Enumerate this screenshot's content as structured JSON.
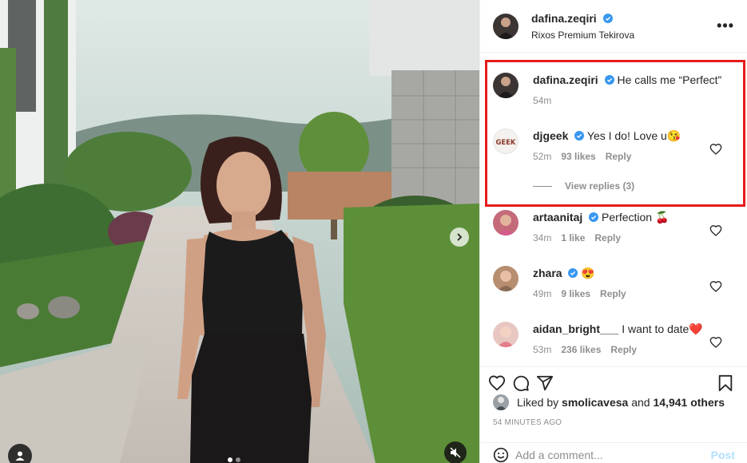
{
  "post": {
    "username": "dafina.zeqiri",
    "location": "Rixos Premium Tekirova",
    "more_label": "•••"
  },
  "comments": [
    {
      "username": "dafina.zeqiri",
      "verified": true,
      "text": "He calls me “Perfect”",
      "time": "54m"
    },
    {
      "username": "djgeek",
      "verified": true,
      "text": "Yes I do! Love u😘",
      "time": "52m",
      "likes": "93 likes",
      "reply": "Reply",
      "view_replies": "View replies (3)"
    },
    {
      "username": "artaanitaj",
      "verified": true,
      "text": "Perfection 🍒",
      "time": "34m",
      "likes": "1 like",
      "reply": "Reply"
    },
    {
      "username": "zhara",
      "verified": true,
      "text": "😍",
      "time": "49m",
      "likes": "9 likes",
      "reply": "Reply"
    },
    {
      "username": "aidan_bright___",
      "verified": false,
      "text": "I want to date❤️",
      "time": "53m",
      "likes": "236 likes",
      "reply": "Reply"
    }
  ],
  "likes_line": {
    "prefix": "Liked by",
    "user": "smolicavesa",
    "and": "and",
    "count": "14,941 others"
  },
  "time_ago": "54 MINUTES AGO",
  "add_comment": {
    "placeholder": "Add a comment...",
    "post_label": "Post"
  },
  "colors": {
    "highlight": "#e61b1b",
    "verified": "#3897f0",
    "link_disabled": "#b2dffc",
    "muted": "#8e8e8e"
  },
  "icons": [
    "verified-badge-icon",
    "more-icon",
    "heart-icon",
    "comment-icon",
    "share-icon",
    "bookmark-icon",
    "emoji-icon",
    "chevron-right-icon",
    "user-tag-icon",
    "mute-icon"
  ]
}
